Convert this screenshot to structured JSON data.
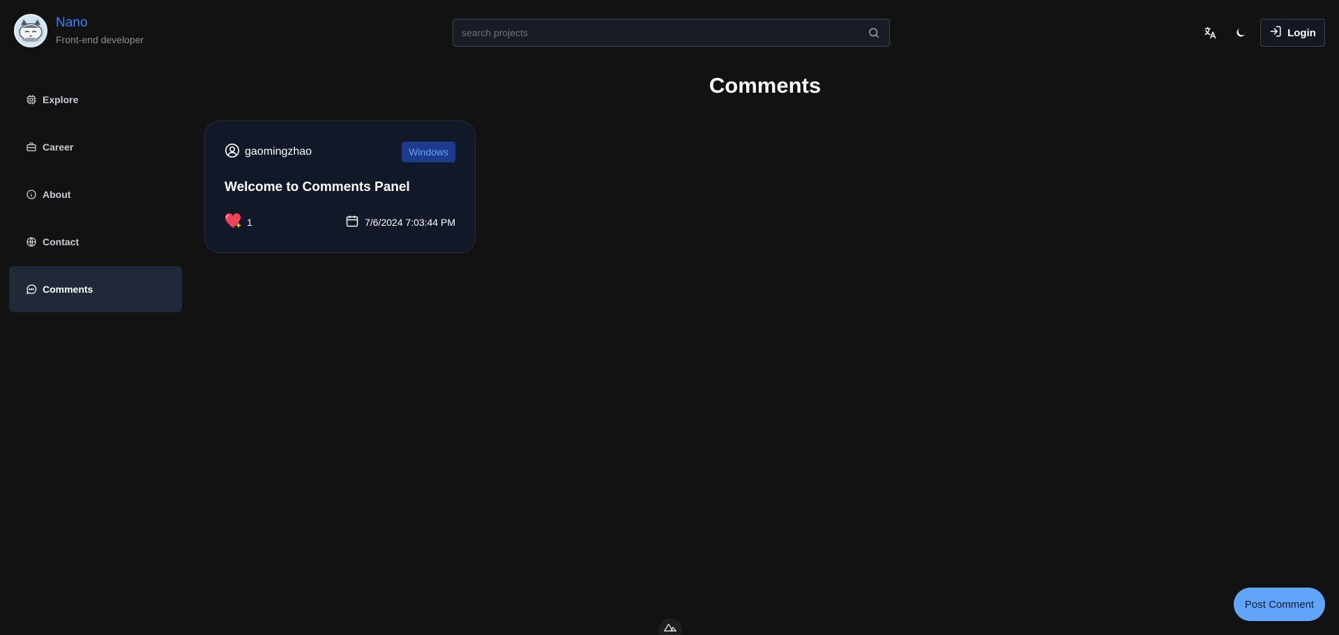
{
  "profile": {
    "name": "Nano",
    "role": "Front-end developer"
  },
  "search": {
    "placeholder": "search projects"
  },
  "header": {
    "login_label": "Login"
  },
  "sidebar": {
    "items": [
      {
        "label": "Explore",
        "icon": "cpu-icon"
      },
      {
        "label": "Career",
        "icon": "briefcase-icon"
      },
      {
        "label": "About",
        "icon": "info-icon"
      },
      {
        "label": "Contact",
        "icon": "globe-icon"
      },
      {
        "label": "Comments",
        "icon": "message-icon",
        "active": true
      }
    ]
  },
  "main": {
    "title": "Comments",
    "comments": [
      {
        "user": "gaomingzhao",
        "platform": "Windows",
        "title": "Welcome to Comments Panel",
        "likes": "1",
        "date": "7/6/2024 7:03:44 PM"
      }
    ]
  },
  "post_button": {
    "label": "Post Comment"
  },
  "colors": {
    "accent": "#3b82f6",
    "button": "#60a5fa",
    "background": "#121212",
    "card": "#111827"
  }
}
